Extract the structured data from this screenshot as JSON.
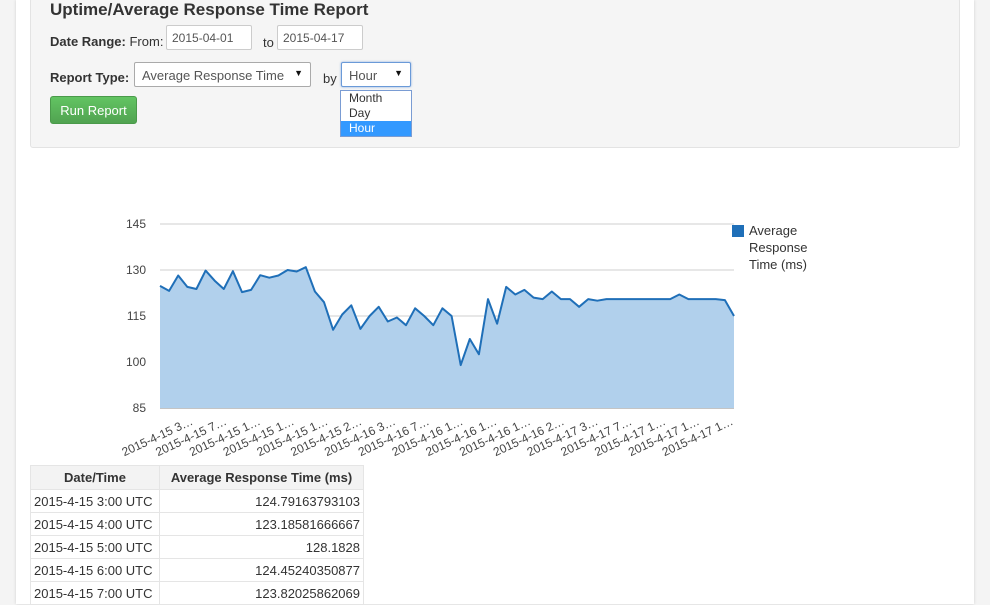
{
  "report": {
    "title": "Uptime/Average Response Time Report",
    "date_range_label": "Date Range:",
    "from_label": "From:",
    "from_value": "2015-04-01",
    "to_label": "to",
    "to_value": "2015-04-17",
    "report_type_label": "Report Type:",
    "report_type_value": "Average Response Time",
    "by_label": "by",
    "by_value": "Hour",
    "by_options": [
      "Month",
      "Day",
      "Hour"
    ],
    "run_button": "Run Report"
  },
  "colors": {
    "series": "#1f6fb8",
    "area": "#b1d0ec",
    "button": "#5cb85c"
  },
  "icons": {
    "select_arrow": "caret-down-icon"
  },
  "chart_data": {
    "type": "area",
    "title": "",
    "xlabel": "",
    "ylabel": "",
    "ylim": [
      85,
      145
    ],
    "yticks": [
      85,
      100,
      115,
      130,
      145
    ],
    "grid": true,
    "legend_placement": "right",
    "x_tick_labels": [
      "2015-4-15 3…",
      "2015-4-15 7…",
      "2015-4-15 1…",
      "2015-4-15 1…",
      "2015-4-15 1…",
      "2015-4-15 2…",
      "2015-4-16 3…",
      "2015-4-16 7…",
      "2015-4-16 1…",
      "2015-4-16 1…",
      "2015-4-16 1…",
      "2015-4-16 2…",
      "2015-4-17 3…",
      "2015-4-17 7…",
      "2015-4-17 1…",
      "2015-4-17 1…",
      "2015-4-17 1…"
    ],
    "series": [
      {
        "name": "Average Response Time (ms)",
        "values": [
          124.8,
          123.2,
          128.2,
          124.5,
          123.8,
          129.8,
          126.5,
          123.8,
          129.6,
          122.8,
          123.5,
          128.3,
          127.5,
          128.2,
          130.0,
          129.5,
          130.9,
          123.0,
          119.5,
          110.5,
          115.5,
          118.5,
          110.8,
          115.0,
          118.0,
          113.2,
          114.5,
          112.0,
          117.5,
          115.0,
          112.0,
          117.5,
          115.0,
          99.0,
          107.5,
          102.5,
          120.5,
          112.5,
          124.5,
          122.0,
          123.5,
          121.0,
          120.5,
          123.0,
          120.5,
          120.5,
          118.0,
          120.5,
          120.0,
          120.5,
          120.5,
          120.5,
          120.5,
          120.5,
          120.5,
          120.5,
          120.5,
          122.0,
          120.5,
          120.5,
          120.5,
          120.5,
          120.2,
          115.0
        ]
      }
    ]
  },
  "table": {
    "columns": [
      "Date/Time",
      "Average Response Time (ms)"
    ],
    "rows": [
      [
        "2015-4-15 3:00 UTC",
        "124.79163793103"
      ],
      [
        "2015-4-15 4:00 UTC",
        "123.18581666667"
      ],
      [
        "2015-4-15 5:00 UTC",
        "128.1828"
      ],
      [
        "2015-4-15 6:00 UTC",
        "124.45240350877"
      ],
      [
        "2015-4-15 7:00 UTC",
        "123.82025862069"
      ]
    ]
  }
}
